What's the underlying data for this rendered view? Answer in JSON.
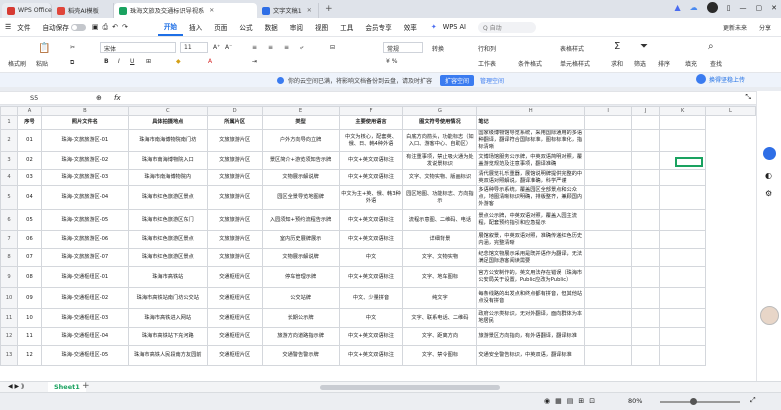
{
  "tabs": [
    {
      "label": "WPS Office",
      "color": "#d63a32"
    },
    {
      "label": "稻壳AI模板",
      "color": "#e0453a"
    },
    {
      "label": "珠海文旅及交通标识导视系",
      "color": "#1aa260",
      "active": true
    },
    {
      "label": "文字文稿1",
      "color": "#2e6ee6"
    }
  ],
  "menu": {
    "file": "文件",
    "autosave": "自动保存",
    "items": [
      "开始",
      "插入",
      "页面",
      "公式",
      "数据",
      "审阅",
      "视图",
      "工具",
      "会员专享",
      "效率"
    ],
    "wps_ai": "WPS AI",
    "search_placeholder": "Q 自动",
    "update": "更新未来",
    "share": "分享"
  },
  "ribbon": {
    "format_painter": "格式刷",
    "paste": "粘贴",
    "cut": "✂",
    "font": "宋体",
    "size": "11",
    "number_format": "常规",
    "convert": "转换",
    "rows_cols": "行和列",
    "worksheet": "工作表",
    "cond_format": "条件格式",
    "table_style": "表格样式",
    "cell_style": "单元格样式",
    "sum": "求和",
    "filter": "筛选",
    "sort": "排序",
    "fill": "填充",
    "find": "查找",
    "cloud_upload": "换得坚稳上传"
  },
  "notice": {
    "text": "你的云空间已满，将影响文档备份到云盘，请及时扩容",
    "btn1": "扩容空间",
    "btn2": "管理空间"
  },
  "formula": {
    "cell_ref": "S5",
    "fx": "fx"
  },
  "columns": [
    "A",
    "B",
    "C",
    "D",
    "E",
    "F",
    "G",
    "H",
    "I",
    "J",
    "K",
    "L",
    "M"
  ],
  "rows": [
    {
      "n": "1",
      "cells": [
        "序号",
        "照片文件名",
        "具体拍摄地点",
        "所属片区",
        "类型",
        "主要使用语言",
        "图文符号使用情况",
        "笔记",
        "",
        "",
        ""
      ]
    },
    {
      "n": "2",
      "cells": [
        "01",
        "珠海-文旅旅游区-01",
        "珠海市南海博物院南门坊",
        "文旅旅游片区",
        "户外方向导向立牌",
        "中文为核心，配套英、俄、日、韩4种外语",
        "白底方向箭头，功能标志（如入口、游客中心、自助区）",
        "国家级博物馆导览系统，采用国际通用的多语种翻译，翻译符合国际标准，图标标准化，指标清晰",
        "",
        "",
        ""
      ]
    },
    {
      "n": "3",
      "cells": [
        "02",
        "珠海-文旅旅游区-02",
        "珠海市南海博物院入口",
        "文旅旅游片区",
        "景区简介+游览须知告示牌",
        "中文+英文双语标注",
        "有注重事项，禁止吸火通为处发说景标识",
        "文博场馆服务公示牌，中英双语简明对照，覆盖游览规范及注意事项，翻译准确",
        "",
        "",
        ""
      ]
    },
    {
      "n": "4",
      "cells": [
        "03",
        "珠海-文旅旅游区-03",
        "珠海市南海博物院内",
        "文旅旅游片区",
        "文物展示解说牌",
        "中文+英文双语标注",
        "文字、文物实物、版画标识",
        "清代展览礼乐重器，展馆说明牌提供完整的中英双语对照解说，翻译准确，科学严谨",
        "",
        "",
        ""
      ]
    },
    {
      "n": "5",
      "cells": [
        "04",
        "珠海-文旅旅游区-04",
        "珠海市红色旅游区景点",
        "文旅旅游片区",
        "园区全景导览地图牌",
        "中文为主+英、俄、韩3种外语",
        "园区地图、功能标志、方向指示",
        "多语种导示系统，覆盖园区全部景点和公众点，地图清晰标识明确，排版整齐，兼顾国内外游客",
        "",
        "",
        ""
      ]
    },
    {
      "n": "6",
      "cells": [
        "05",
        "珠海-文旅旅游区-05",
        "珠海市红色旅游区东门",
        "文旅旅游片区",
        "入园须知+预约流程告示牌",
        "中文+英文双语标注",
        "流程示意图、二维码、电话",
        "景点公示牌，中英双语对照，覆盖入园主流程，配套预约指引和应急提示",
        "",
        "",
        ""
      ]
    },
    {
      "n": "7",
      "cells": [
        "06",
        "珠海-文旅旅游区-06",
        "珠海市红色旅游区景点",
        "文旅旅游片区",
        "室内历史展牌展示",
        "中文+英文双语标注",
        "详细背景",
        "展馆叙景，中英双语对照，准确传递红色历史内涵，完整清晰",
        "",
        "",
        ""
      ]
    },
    {
      "n": "8",
      "cells": [
        "07",
        "珠海-文旅旅游区-07",
        "珠海市红色旅游区景点",
        "文旅旅游片区",
        "文物展示解说牌",
        "中文",
        "文字、文物实物",
        "纪念馆文物展示采用是既并语作为翻译，无法满足国际游客阅读需要",
        "",
        "",
        ""
      ]
    },
    {
      "n": "9",
      "cells": [
        "08",
        "珠海-交通枢纽区-01",
        "珠海市高铁站",
        "交通枢纽片区",
        "停车管理示牌",
        "中文+英文双语标注",
        "文字、地车图标",
        "官方公安制作的，英文用法存在错误（珠海市公安局关于设置，Public应改为Public）",
        "",
        "",
        ""
      ]
    },
    {
      "n": "10",
      "cells": [
        "09",
        "珠海-交通枢纽区-02",
        "珠海市高铁站南门坊公交站",
        "交通枢纽片区",
        "公交站牌",
        "中文、少量拼音",
        "纯文字",
        "每条线路的出发点和终点都有拼音，但其他站点没有拼音",
        "",
        "",
        ""
      ]
    },
    {
      "n": "11",
      "cells": [
        "10",
        "珠海-交通枢纽区-03",
        "珠海市高铁进入网站",
        "交通枢纽片区",
        "长期公示牌",
        "中文",
        "文字、联系电话、二维码",
        "政府公示类标识，无对外翻译，面向群体为本地居民",
        "",
        "",
        ""
      ]
    },
    {
      "n": "12",
      "cells": [
        "11",
        "珠海-交通枢纽区-04",
        "珠海市高铁站下充河路",
        "交通枢纽片区",
        "旅游方向道路指示牌",
        "中文+英文双语标注",
        "文字、距离方向",
        "旅游景区方向指向，有外语翻译，翻译标准",
        "",
        "",
        ""
      ]
    },
    {
      "n": "13",
      "cells": [
        "12",
        "珠海-交通枢纽区-05",
        "珠海市高铁人民段南方友园前",
        "交通枢纽片区",
        "交通警告警示牌",
        "中文+英文双语标注",
        "文字、禁令图标",
        "交通安全警告标识，中英双语，翻译标准",
        "",
        "",
        ""
      ]
    }
  ],
  "sheet": {
    "name": "Sheet1",
    "add": "+"
  },
  "status": {
    "zoom": "80%"
  }
}
